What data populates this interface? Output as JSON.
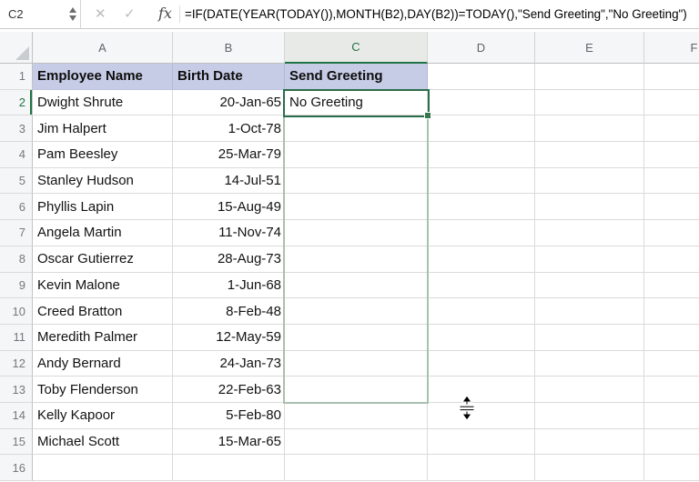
{
  "formula_bar": {
    "cell_reference": "C2",
    "cancel_icon": "✕",
    "confirm_icon": "✓",
    "fx_icon": "fx",
    "formula": "=IF(DATE(YEAR(TODAY()),MONTH(B2),DAY(B2))=TODAY(),\"Send Greeting\",\"No Greeting\")"
  },
  "column_headers": [
    "A",
    "B",
    "C",
    "D",
    "E",
    "F"
  ],
  "selection": {
    "active_cell": "C2",
    "column": "C",
    "row": "2",
    "range_outline_end_row": "13",
    "active_cell_value": "No Greeting"
  },
  "sheet": {
    "header_row": {
      "row_number": "1",
      "employee_name": "Employee Name",
      "birth_date": "Birth Date",
      "greeting": "Send Greeting"
    },
    "rows": [
      {
        "row_number": "2",
        "name": "Dwight Shrute",
        "birth_date": "20-Jan-65",
        "greeting": "No Greeting"
      },
      {
        "row_number": "3",
        "name": "Jim Halpert",
        "birth_date": "1-Oct-78",
        "greeting": ""
      },
      {
        "row_number": "4",
        "name": "Pam Beesley",
        "birth_date": "25-Mar-79",
        "greeting": ""
      },
      {
        "row_number": "5",
        "name": "Stanley Hudson",
        "birth_date": "14-Jul-51",
        "greeting": ""
      },
      {
        "row_number": "6",
        "name": "Phyllis Lapin",
        "birth_date": "15-Aug-49",
        "greeting": ""
      },
      {
        "row_number": "7",
        "name": "Angela Martin",
        "birth_date": "11-Nov-74",
        "greeting": ""
      },
      {
        "row_number": "8",
        "name": "Oscar Gutierrez",
        "birth_date": "28-Aug-73",
        "greeting": ""
      },
      {
        "row_number": "9",
        "name": "Kevin Malone",
        "birth_date": "1-Jun-68",
        "greeting": ""
      },
      {
        "row_number": "10",
        "name": "Creed Bratton",
        "birth_date": "8-Feb-48",
        "greeting": ""
      },
      {
        "row_number": "11",
        "name": "Meredith Palmer",
        "birth_date": "12-May-59",
        "greeting": ""
      },
      {
        "row_number": "12",
        "name": "Andy Bernard",
        "birth_date": "24-Jan-73",
        "greeting": ""
      },
      {
        "row_number": "13",
        "name": "Toby Flenderson",
        "birth_date": "22-Feb-63",
        "greeting": ""
      },
      {
        "row_number": "14",
        "name": "Kelly Kapoor",
        "birth_date": "5-Feb-80",
        "greeting": ""
      },
      {
        "row_number": "15",
        "name": "Michael Scott",
        "birth_date": "15-Mar-65",
        "greeting": ""
      },
      {
        "row_number": "16",
        "name": "",
        "birth_date": "",
        "greeting": ""
      }
    ]
  },
  "colors": {
    "header_fill": "#c7cce6",
    "accent_green": "#217346",
    "active_cell_border": "#2c6e4b",
    "range_outline": "#a9c0b0",
    "gridline": "#dadada"
  }
}
